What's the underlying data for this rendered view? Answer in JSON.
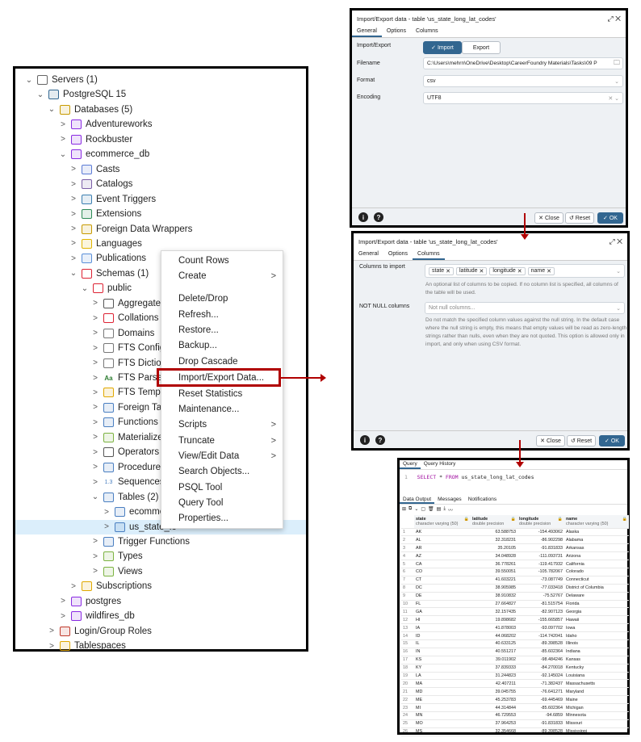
{
  "tree": {
    "nodes": [
      {
        "label": "Servers (1)",
        "chev": "⌄",
        "icon": "servers-icon"
      },
      {
        "label": "PostgreSQL 15",
        "chev": "⌄",
        "icon": "postgres-icon"
      },
      {
        "label": "Databases (5)",
        "chev": "⌄",
        "icon": "databases-icon"
      },
      {
        "label": "Adventureworks",
        "chev": ">",
        "icon": "database-icon"
      },
      {
        "label": "Rockbuster",
        "chev": ">",
        "icon": "database-icon"
      },
      {
        "label": "ecommerce_db",
        "chev": "⌄",
        "icon": "database-icon"
      },
      {
        "label": "Casts",
        "chev": ">",
        "icon": "casts-icon"
      },
      {
        "label": "Catalogs",
        "chev": ">",
        "icon": "catalogs-icon"
      },
      {
        "label": "Event Triggers",
        "chev": ">",
        "icon": "event-triggers-icon"
      },
      {
        "label": "Extensions",
        "chev": ">",
        "icon": "extensions-icon"
      },
      {
        "label": "Foreign Data Wrappers",
        "chev": ">",
        "icon": "foreign-data-wrappers-icon"
      },
      {
        "label": "Languages",
        "chev": ">",
        "icon": "languages-icon"
      },
      {
        "label": "Publications",
        "chev": ">",
        "icon": "publications-icon"
      },
      {
        "label": "Schemas (1)",
        "chev": "⌄",
        "icon": "schemas-icon"
      },
      {
        "label": "public",
        "chev": "⌄",
        "icon": "schema-icon"
      },
      {
        "label": "Aggregates",
        "chev": ">",
        "icon": "aggregates-icon"
      },
      {
        "label": "Collations",
        "chev": ">",
        "icon": "collations-icon"
      },
      {
        "label": "Domains",
        "chev": ">",
        "icon": "domains-icon"
      },
      {
        "label": "FTS Configura",
        "chev": ">",
        "icon": "fts-configurations-icon"
      },
      {
        "label": "FTS Dictionari",
        "chev": ">",
        "icon": "fts-dictionaries-icon"
      },
      {
        "label": "FTS Parsers",
        "chev": ">",
        "icon": "fts-parsers-icon"
      },
      {
        "label": "FTS Template",
        "chev": ">",
        "icon": "fts-templates-icon"
      },
      {
        "label": "Foreign Tables",
        "chev": ">",
        "icon": "foreign-tables-icon"
      },
      {
        "label": "Functions",
        "chev": ">",
        "icon": "functions-icon"
      },
      {
        "label": "Materialized V",
        "chev": ">",
        "icon": "materialized-views-icon"
      },
      {
        "label": "Operators",
        "chev": ">",
        "icon": "operators-icon"
      },
      {
        "label": "Procedures",
        "chev": ">",
        "icon": "procedures-icon"
      },
      {
        "label": "Sequences",
        "chev": ">",
        "icon": "sequences-icon"
      },
      {
        "label": "Tables (2)",
        "chev": "⌄",
        "icon": "tables-icon"
      },
      {
        "label": "ecommerce",
        "chev": ">",
        "icon": "table-icon"
      },
      {
        "label": "us_state_lo",
        "chev": ">",
        "icon": "table-icon"
      },
      {
        "label": "Trigger Functions",
        "chev": ">",
        "icon": "trigger-functions-icon"
      },
      {
        "label": "Types",
        "chev": ">",
        "icon": "types-icon"
      },
      {
        "label": "Views",
        "chev": ">",
        "icon": "views-icon"
      },
      {
        "label": "Subscriptions",
        "chev": ">",
        "icon": "subscriptions-icon"
      },
      {
        "label": "postgres",
        "chev": ">",
        "icon": "database-icon"
      },
      {
        "label": "wildfires_db",
        "chev": ">",
        "icon": "database-icon"
      },
      {
        "label": "Login/Group Roles",
        "chev": ">",
        "icon": "roles-icon"
      },
      {
        "label": "Tablespaces",
        "chev": ">",
        "icon": "tablespaces-icon"
      }
    ]
  },
  "context_menu": {
    "items": [
      {
        "label": "Count Rows",
        "sub": ""
      },
      {
        "label": "Create",
        "sub": ">"
      },
      {
        "label": "Delete/Drop",
        "sub": ""
      },
      {
        "label": "Refresh...",
        "sub": ""
      },
      {
        "label": "Restore...",
        "sub": ""
      },
      {
        "label": "Backup...",
        "sub": ""
      },
      {
        "label": "Drop Cascade",
        "sub": ""
      },
      {
        "label": "Import/Export Data...",
        "sub": ""
      },
      {
        "label": "Reset Statistics",
        "sub": ""
      },
      {
        "label": "Maintenance...",
        "sub": ""
      },
      {
        "label": "Scripts",
        "sub": ">"
      },
      {
        "label": "Truncate",
        "sub": ">"
      },
      {
        "label": "View/Edit Data",
        "sub": ">"
      },
      {
        "label": "Search Objects...",
        "sub": ""
      },
      {
        "label": "PSQL Tool",
        "sub": ""
      },
      {
        "label": "Query Tool",
        "sub": ""
      },
      {
        "label": "Properties...",
        "sub": ""
      }
    ]
  },
  "dialog1": {
    "title": "Import/Export data - table 'us_state_long_lat_codes'",
    "tabs": [
      "General",
      "Options",
      "Columns"
    ],
    "import_export_label": "Import/Export",
    "import_label": "Import",
    "export_label": "Export",
    "filename_label": "Filename",
    "filename_value": "C:\\Users\\mehrn\\OneDrive\\Desktop\\CareerFoundry Materials\\Tasks\\09 P",
    "format_label": "Format",
    "format_value": "csv",
    "encoding_label": "Encoding",
    "encoding_value": "UTF8",
    "close_label": "Close",
    "reset_label": "Reset",
    "ok_label": "OK"
  },
  "dialog2": {
    "title": "Import/Export data - table 'us_state_long_lat_codes'",
    "tabs": [
      "General",
      "Options",
      "Columns"
    ],
    "columns_label": "Columns to import",
    "columns": [
      "state",
      "latitude",
      "longitude",
      "name"
    ],
    "columns_help": "An optional list of columns to be copied. If no column list is specified, all columns of the table will be used.",
    "notnull_label": "NOT NULL columns",
    "notnull_placeholder": "Not null columns...",
    "notnull_help": "Do not match the specified column values against the null string. In the default case where the null string is empty, this means that empty values will be read as zero-length strings rather than nulls, even when they are not quoted. This option is allowed only in import, and only when using CSV format.",
    "close_label": "Close",
    "reset_label": "Reset",
    "ok_label": "OK"
  },
  "query": {
    "tabs": [
      "Query",
      "Query History"
    ],
    "line_no": "1",
    "kw_select": "SELECT",
    "star": "*",
    "kw_from": "FROM",
    "table": "us_state_long_lat_codes",
    "out_tabs": [
      "Data Output",
      "Messages",
      "Notifications"
    ],
    "headers": [
      {
        "name": "state",
        "type": "character varying (50)"
      },
      {
        "name": "latitude",
        "type": "double precision"
      },
      {
        "name": "longitude",
        "type": "double precision"
      },
      {
        "name": "name",
        "type": "character varying (50)"
      }
    ],
    "rows": [
      [
        "1",
        "AK",
        "63.588753",
        "-154.493062",
        "Alaska"
      ],
      [
        "2",
        "AL",
        "32.318231",
        "-86.902298",
        "Alabama"
      ],
      [
        "3",
        "AR",
        "35.20105",
        "-91.831833",
        "Arkansas"
      ],
      [
        "4",
        "AZ",
        "34.048928",
        "-111.093731",
        "Arizona"
      ],
      [
        "5",
        "CA",
        "36.778261",
        "-119.417932",
        "California"
      ],
      [
        "6",
        "CO",
        "39.550051",
        "-105.782067",
        "Colorado"
      ],
      [
        "7",
        "CT",
        "41.603221",
        "-73.087749",
        "Connecticut"
      ],
      [
        "8",
        "DC",
        "38.905985",
        "-77.033418",
        "District of Columbia"
      ],
      [
        "9",
        "DE",
        "38.910832",
        "-75.52767",
        "Delaware"
      ],
      [
        "10",
        "FL",
        "27.664827",
        "-81.515754",
        "Florida"
      ],
      [
        "11",
        "GA",
        "32.157435",
        "-82.907123",
        "Georgia"
      ],
      [
        "12",
        "HI",
        "19.898682",
        "-155.665857",
        "Hawaii"
      ],
      [
        "13",
        "IA",
        "41.878003",
        "-93.097702",
        "Iowa"
      ],
      [
        "14",
        "ID",
        "44.068202",
        "-114.742041",
        "Idaho"
      ],
      [
        "15",
        "IL",
        "40.633125",
        "-89.398528",
        "Illinois"
      ],
      [
        "16",
        "IN",
        "40.551217",
        "-85.602364",
        "Indiana"
      ],
      [
        "17",
        "KS",
        "39.011902",
        "-98.484246",
        "Kansas"
      ],
      [
        "18",
        "KY",
        "37.839333",
        "-84.270018",
        "Kentucky"
      ],
      [
        "19",
        "LA",
        "31.244823",
        "-92.145024",
        "Louisiana"
      ],
      [
        "20",
        "MA",
        "42.407211",
        "-71.382437",
        "Massachusetts"
      ],
      [
        "21",
        "MD",
        "39.045755",
        "-76.641271",
        "Maryland"
      ],
      [
        "22",
        "ME",
        "45.253783",
        "-69.445469",
        "Maine"
      ],
      [
        "23",
        "MI",
        "44.314844",
        "-85.602364",
        "Michigan"
      ],
      [
        "24",
        "MN",
        "46.729553",
        "-94.6859",
        "Minnesota"
      ],
      [
        "25",
        "MO",
        "37.964253",
        "-91.831833",
        "Missouri"
      ],
      [
        "26",
        "MS",
        "32.354668",
        "-89.398528",
        "Mississippi"
      ]
    ]
  }
}
